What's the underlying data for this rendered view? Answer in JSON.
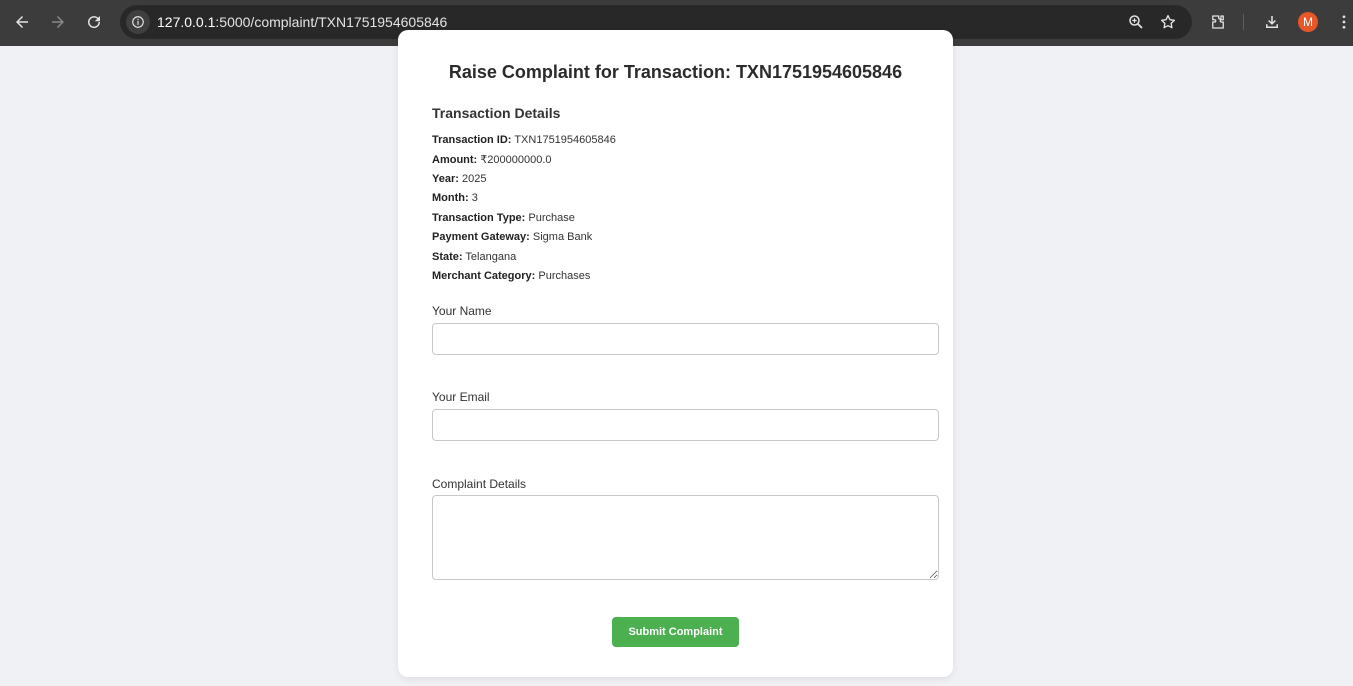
{
  "browser": {
    "url_host": "127.0.0.1",
    "url_rest": ":5000/complaint/TXN1751954605846",
    "avatar_letter": "M"
  },
  "page": {
    "title": "Raise Complaint for Transaction: TXN1751954605846",
    "details_heading": "Transaction Details",
    "details": [
      {
        "label": "Transaction ID:",
        "value": "TXN1751954605846"
      },
      {
        "label": "Amount:",
        "value": "₹200000000.0"
      },
      {
        "label": "Year:",
        "value": "2025"
      },
      {
        "label": "Month:",
        "value": "3"
      },
      {
        "label": "Transaction Type:",
        "value": "Purchase"
      },
      {
        "label": "Payment Gateway:",
        "value": "Sigma Bank"
      },
      {
        "label": "State:",
        "value": "Telangana"
      },
      {
        "label": "Merchant Category:",
        "value": "Purchases"
      }
    ],
    "form": {
      "name_label": "Your Name",
      "name_value": "",
      "email_label": "Your Email",
      "email_value": "",
      "complaint_label": "Complaint Details",
      "complaint_value": "",
      "submit_label": "Submit Complaint"
    }
  },
  "colors": {
    "chrome_bg": "#3c3c3c",
    "submit_bg": "#4caf50",
    "avatar_bg": "#e8572a",
    "page_bg": "#f0f1f5"
  }
}
